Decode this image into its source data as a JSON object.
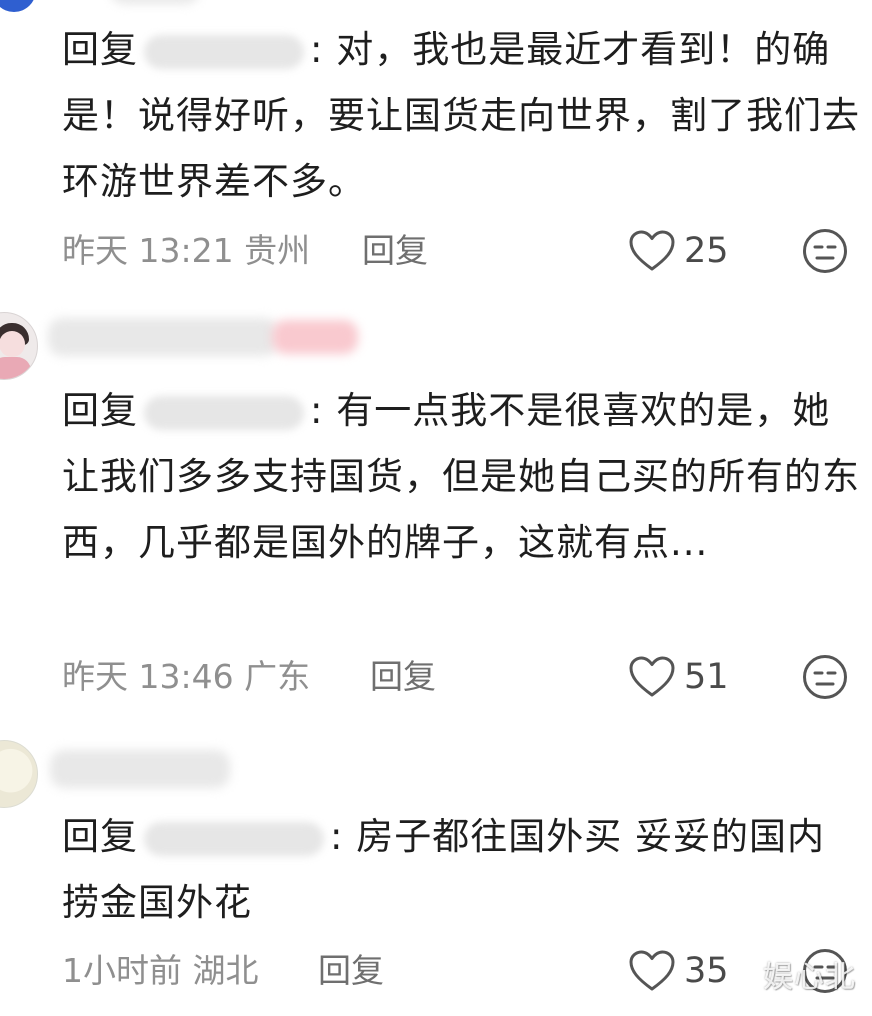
{
  "comments": [
    {
      "reply_prefix": "回复",
      "text": ": 对，我也是最近才看到！的确是！说得好听，要让国货走向世界，割了我们去环游世界差不多。",
      "time_location": "昨天 13:21 贵州",
      "reply_label": "回复",
      "likes": "25"
    },
    {
      "reply_prefix": "回复",
      "text": ": 有一点我不是很喜欢的是，她让我们多多支持国货，但是她自己买的所有的东西，几乎都是国外的牌子，这就有点...",
      "time_location": "昨天 13:46 广东",
      "reply_label": "回复",
      "likes": "51"
    },
    {
      "reply_prefix": "回复",
      "text": ": 房子都往国外买 妥妥的国内捞金国外花",
      "time_location": "1小时前 湖北",
      "reply_label": "回复",
      "likes": "35"
    }
  ],
  "watermark": "娱心北",
  "colors": {
    "text": "#1e1e1e",
    "meta": "#8f8f8f",
    "icon": "#555555"
  },
  "icons": [
    "heart-outline-icon",
    "dislike-face-icon"
  ]
}
